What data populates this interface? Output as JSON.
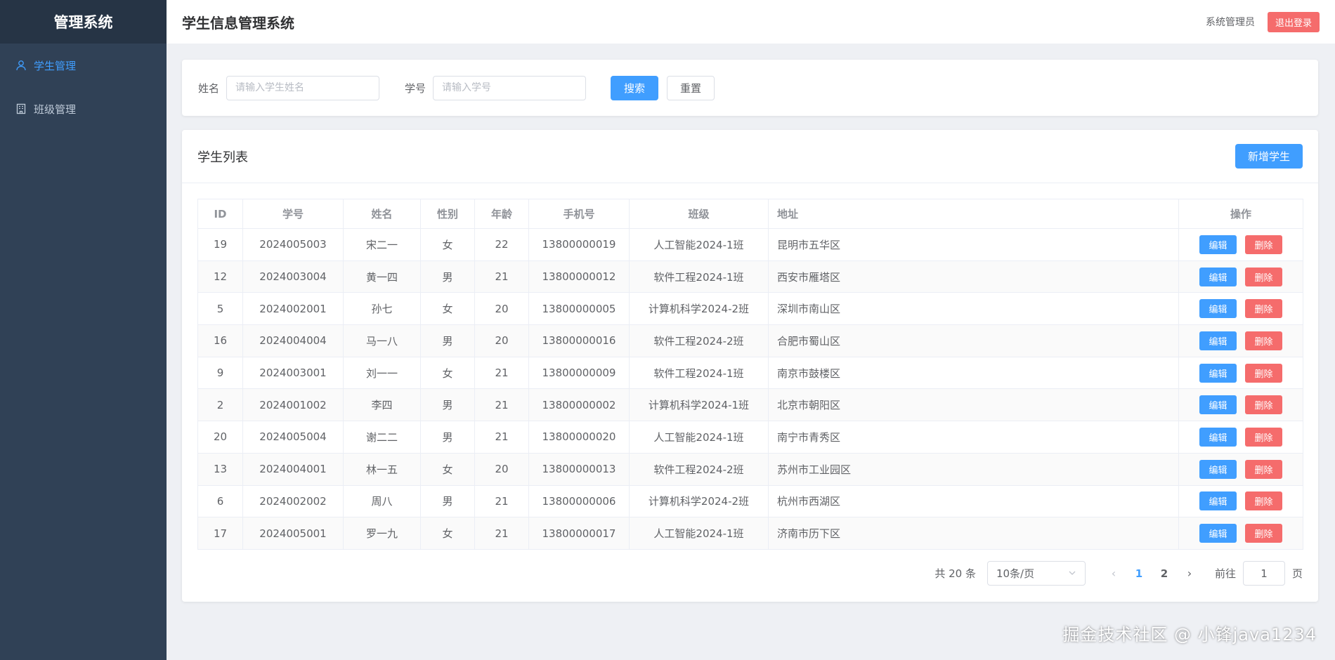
{
  "sidebar": {
    "brand": "管理系统",
    "items": [
      {
        "label": "学生管理",
        "icon": "user-icon",
        "active": true
      },
      {
        "label": "班级管理",
        "icon": "building-icon",
        "active": false
      }
    ]
  },
  "header": {
    "title": "学生信息管理系统",
    "user": "系统管理员",
    "logout_label": "退出登录"
  },
  "search": {
    "name_label": "姓名",
    "name_placeholder": "请输入学生姓名",
    "id_label": "学号",
    "id_placeholder": "请输入学号",
    "search_label": "搜索",
    "reset_label": "重置"
  },
  "list": {
    "title": "学生列表",
    "add_label": "新增学生",
    "columns": [
      "ID",
      "学号",
      "姓名",
      "性别",
      "年龄",
      "手机号",
      "班级",
      "地址",
      "操作"
    ],
    "edit_label": "编辑",
    "delete_label": "删除",
    "rows": [
      [
        "19",
        "2024005003",
        "宋二一",
        "女",
        "22",
        "13800000019",
        "人工智能2024-1班",
        "昆明市五华区"
      ],
      [
        "12",
        "2024003004",
        "黄一四",
        "男",
        "21",
        "13800000012",
        "软件工程2024-1班",
        "西安市雁塔区"
      ],
      [
        "5",
        "2024002001",
        "孙七",
        "女",
        "20",
        "13800000005",
        "计算机科学2024-2班",
        "深圳市南山区"
      ],
      [
        "16",
        "2024004004",
        "马一八",
        "男",
        "20",
        "13800000016",
        "软件工程2024-2班",
        "合肥市蜀山区"
      ],
      [
        "9",
        "2024003001",
        "刘一一",
        "女",
        "21",
        "13800000009",
        "软件工程2024-1班",
        "南京市鼓楼区"
      ],
      [
        "2",
        "2024001002",
        "李四",
        "男",
        "21",
        "13800000002",
        "计算机科学2024-1班",
        "北京市朝阳区"
      ],
      [
        "20",
        "2024005004",
        "谢二二",
        "男",
        "21",
        "13800000020",
        "人工智能2024-1班",
        "南宁市青秀区"
      ],
      [
        "13",
        "2024004001",
        "林一五",
        "女",
        "20",
        "13800000013",
        "软件工程2024-2班",
        "苏州市工业园区"
      ],
      [
        "6",
        "2024002002",
        "周八",
        "男",
        "21",
        "13800000006",
        "计算机科学2024-2班",
        "杭州市西湖区"
      ],
      [
        "17",
        "2024005001",
        "罗一九",
        "女",
        "21",
        "13800000017",
        "人工智能2024-1班",
        "济南市历下区"
      ]
    ]
  },
  "pagination": {
    "total": "共 20 条",
    "page_size": "10条/页",
    "prev_icon": "chevron-left-icon",
    "next_icon": "chevron-right-icon",
    "pages": [
      "1",
      "2"
    ],
    "current_page": "1",
    "goto_label": "前往",
    "goto_value": "1",
    "page_suffix": "页"
  },
  "watermark": "掘金技术社区 @ 小锋java1234",
  "colors": {
    "primary": "#409eff",
    "danger": "#f56c6c",
    "sidebar_bg": "#304156",
    "brand_bg": "#263445"
  }
}
